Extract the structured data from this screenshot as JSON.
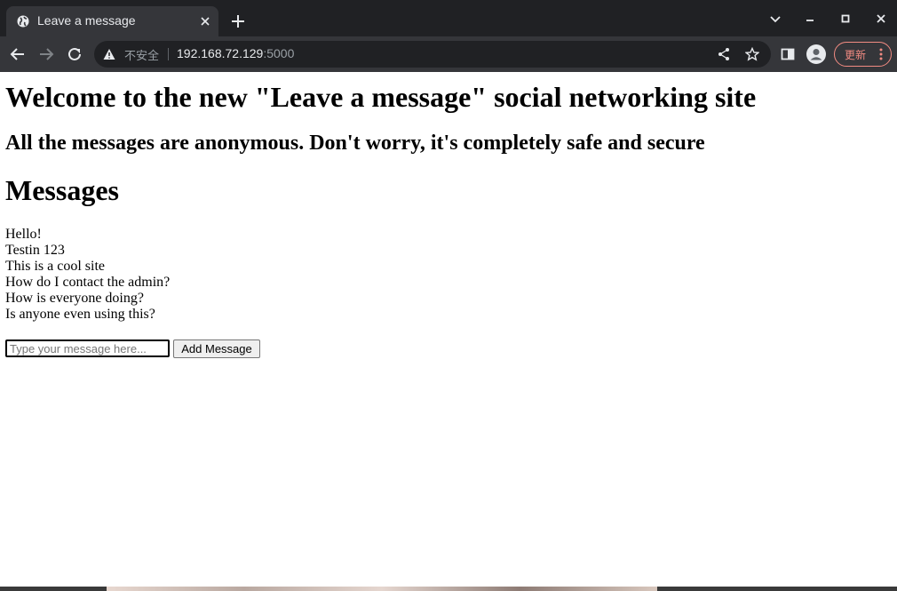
{
  "browser": {
    "tab_title": "Leave a message",
    "security_label": "不安全",
    "url_host": "192.168.72.129",
    "url_port": ":5000",
    "update_label": "更新"
  },
  "page": {
    "heading": "Welcome to the new \"Leave a message\" social networking site",
    "subheading": "All the messages are anonymous. Don't worry, it's completely safe and secure",
    "messages_heading": "Messages",
    "messages": [
      "Hello!",
      "Testin 123",
      "This is a cool site",
      "How do I contact the admin?",
      "How is everyone doing?",
      "Is anyone even using this?"
    ],
    "input_placeholder": "Type your message here...",
    "add_button_label": "Add Message"
  }
}
